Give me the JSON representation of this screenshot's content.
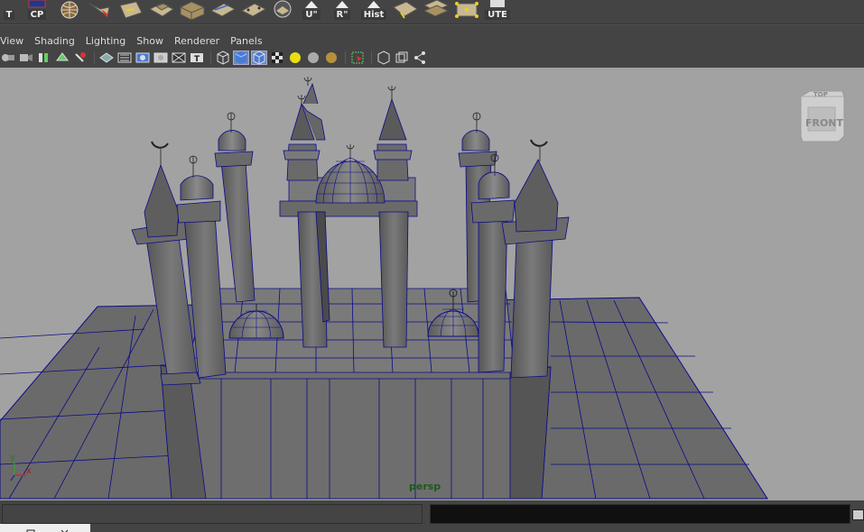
{
  "shelf": {
    "buttons": [
      {
        "label": "T",
        "icon": "partial-tool-icon"
      },
      {
        "label": "CP",
        "icon": "center-pivot-icon"
      },
      {
        "label": "",
        "icon": "sphere-wire-icon"
      },
      {
        "label": "",
        "icon": "select-cursor-icon"
      },
      {
        "label": "",
        "icon": "poly-pencil-icon"
      },
      {
        "label": "",
        "icon": "extrude-face-icon"
      },
      {
        "label": "",
        "icon": "extrude-cube-icon"
      },
      {
        "label": "",
        "icon": "split-plane-icon"
      },
      {
        "label": "",
        "icon": "merge-plane-icon"
      },
      {
        "label": "",
        "icon": "circle-select-icon"
      },
      {
        "label": "U\"",
        "icon": "uv-up-icon"
      },
      {
        "label": "R\"",
        "icon": "reset-icon"
      },
      {
        "label": "Hist",
        "icon": "history-icon"
      },
      {
        "label": "",
        "icon": "plane-edit-icon"
      },
      {
        "label": "",
        "icon": "plane-stack-icon"
      },
      {
        "label": "",
        "icon": "lattice-icon"
      },
      {
        "label": "UTE",
        "icon": "ute-icon"
      }
    ]
  },
  "panel_menu": [
    "View",
    "Shading",
    "Lighting",
    "Show",
    "Renderer",
    "Panels"
  ],
  "panel_toolbar": {
    "icons": [
      "camera-select-icon",
      "camera-attributes-icon",
      "bookmark-icon",
      "image-plane-icon",
      "2d-pan-zoom-icon",
      "grid-icon",
      "film-gate-icon",
      "resolution-gate-icon",
      "gate-mask-icon",
      "field-chart-icon",
      "safe-title-icon",
      "wireframe-icon",
      "smooth-shade-icon",
      "wireframe-on-shaded-icon",
      "textured-icon",
      "use-all-lights-icon",
      "shadows-icon",
      "ambient-occlusion-icon",
      "isolate-select-icon",
      "xray-icon",
      "xray-joints-icon",
      "share-icon"
    ]
  },
  "viewport": {
    "camera_label": "persp",
    "viewcube_top": "TOP",
    "viewcube_front": "FRONT",
    "axis_y": "y",
    "axis_x": "x"
  },
  "colors": {
    "viewport_bg": "#a2a2a2",
    "wire": "#0a0a8a",
    "mesh": "#6e6e6e",
    "ui_bg": "#444444"
  }
}
